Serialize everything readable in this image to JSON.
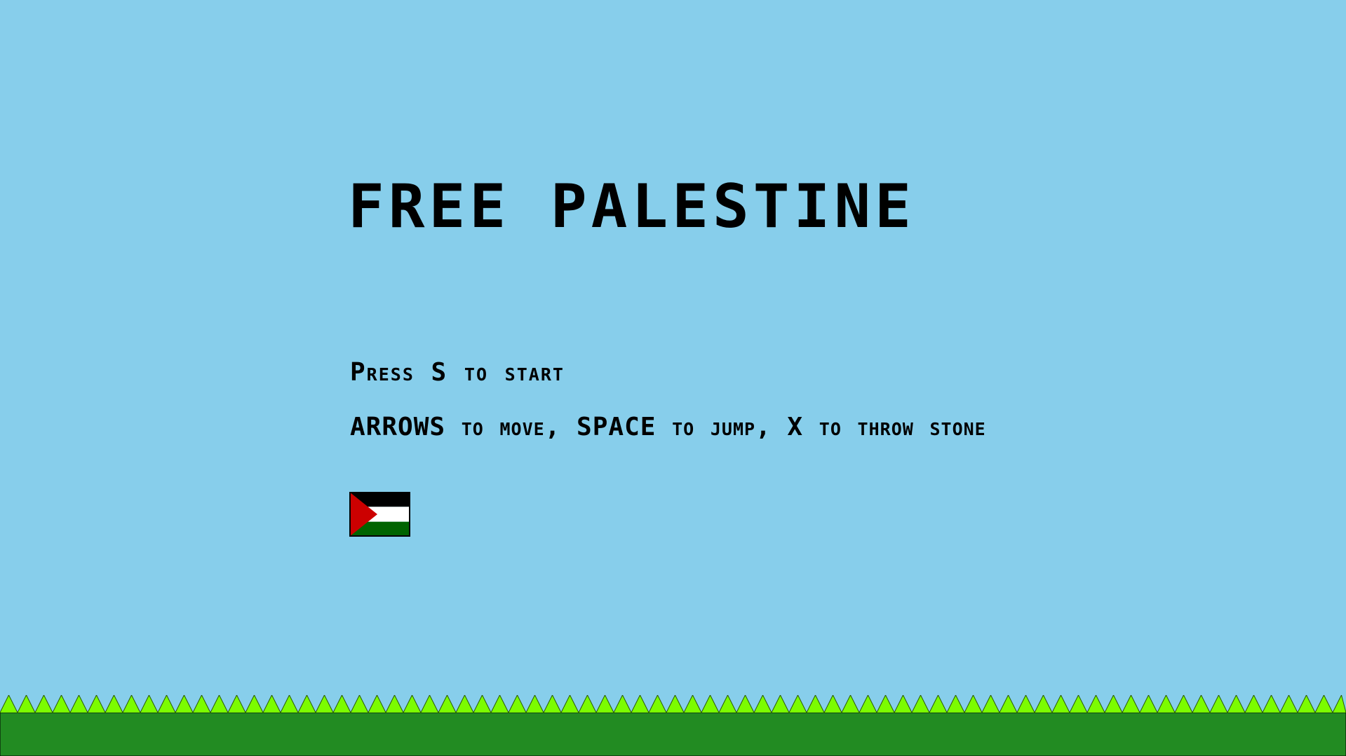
{
  "screen": "title",
  "title": "FREE PALESTINE",
  "instructions": {
    "start": "Press S to start",
    "controls": "ARROWS to move, SPACE to jump, X to throw stone"
  },
  "flag": {
    "icon": "palestine-flag-icon",
    "colors": {
      "top": "#000000",
      "middle": "#FFFFFF",
      "bottom": "#006400",
      "triangle": "#CC0000"
    }
  },
  "colors": {
    "sky": "#87CEEB",
    "grass_spikes": "#7CFC00",
    "ground": "#228B22",
    "text": "#000000"
  }
}
